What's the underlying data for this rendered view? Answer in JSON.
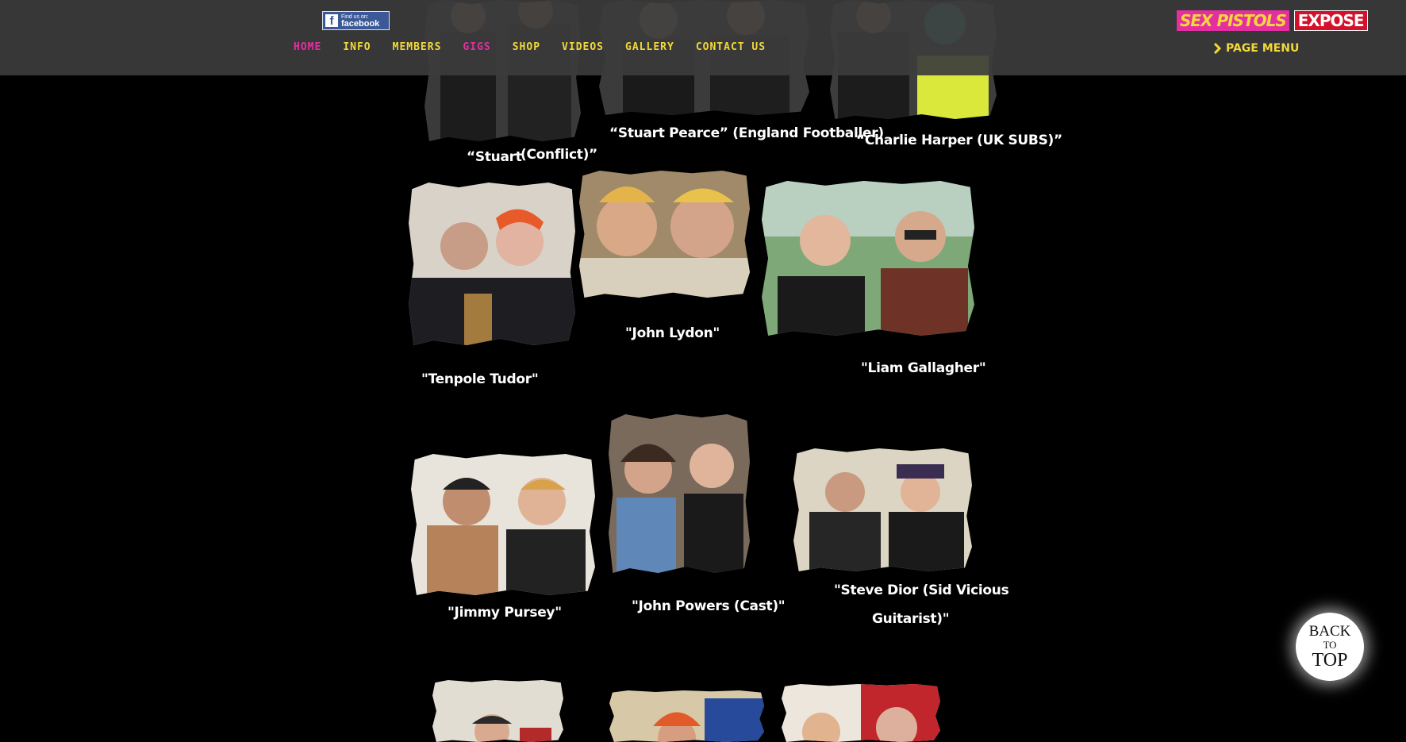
{
  "header": {
    "facebook_badge": {
      "small": "Find us on:",
      "big": "facebook"
    },
    "nav": [
      {
        "label": "HOME",
        "color": "#e42fa0"
      },
      {
        "label": "INFO",
        "color": "#f2d83a"
      },
      {
        "label": "MEMBERS",
        "color": "#f2d83a"
      },
      {
        "label": "GIGS",
        "color": "#e42fa0"
      },
      {
        "label": "SHOP",
        "color": "#f2d83a"
      },
      {
        "label": "VIDEOS",
        "color": "#f2d83a"
      },
      {
        "label": "GALLERY",
        "color": "#f2d83a"
      },
      {
        "label": "CONTACT US",
        "color": "#f2d83a"
      }
    ],
    "logo": {
      "part1": "SEX PISTOLS",
      "part2": "EXPOSE"
    },
    "page_menu": {
      "label": "PAGE MENU",
      "icon": "chevron-right-icon"
    }
  },
  "gallery": {
    "captions": [
      "“Stuart",
      "(Conflict)”",
      "“Stuart Pearce” (England Footballer)",
      "“Charlie Harper (UK  SUBS)”",
      "\"Tenpole Tudor\"",
      "\"John Lydon\"",
      "\"Liam Gallagher\"",
      "\"Jimmy Pursey\"",
      "\"John Powers (Cast)\"",
      "\"Steve Dior (Sid Vicious",
      "Guitarist)\""
    ]
  },
  "back_to_top": {
    "line1": "BACK",
    "line2": "TO",
    "line3": "TOP"
  },
  "colors": {
    "accent_yellow": "#f2d83a",
    "accent_pink": "#e42fa0",
    "background": "#000000"
  }
}
